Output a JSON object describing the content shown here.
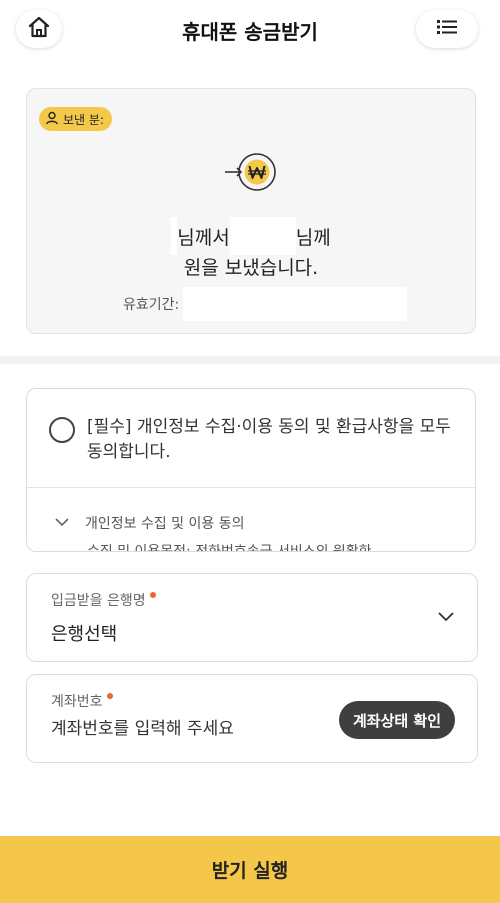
{
  "header": {
    "title": "휴대폰 송금받기",
    "home_icon": "home-icon",
    "menu_icon": "list-icon"
  },
  "sender": {
    "badge_label": "보낸 분:",
    "badge_icon": "person-icon",
    "coin_icon": "won-coin-icon",
    "line1_a": "님께서",
    "line1_b": "님께",
    "line2": "원을 보냈습니다.",
    "validity_label": "유효기간:"
  },
  "agreement": {
    "main_text": "[필수] 개인정보 수집·이용 동의 및 환급사항을 모두 동의합니다.",
    "detail_title": "개인정보 수집 및 이용 동의",
    "detail_sub": "수집 및 이용목적: 전화번호송금 서비스의 원활한"
  },
  "bank_field": {
    "label": "입금받을 은행명",
    "value": "은행선택"
  },
  "account_field": {
    "label": "계좌번호",
    "placeholder": "계좌번호를 입력해 주세요",
    "check_button": "계좌상태 확인"
  },
  "cta": {
    "label": "받기 실행"
  },
  "colors": {
    "accent": "#f4c64a",
    "required_dot": "#e36b2c",
    "dark_button": "#3f3f3f"
  }
}
